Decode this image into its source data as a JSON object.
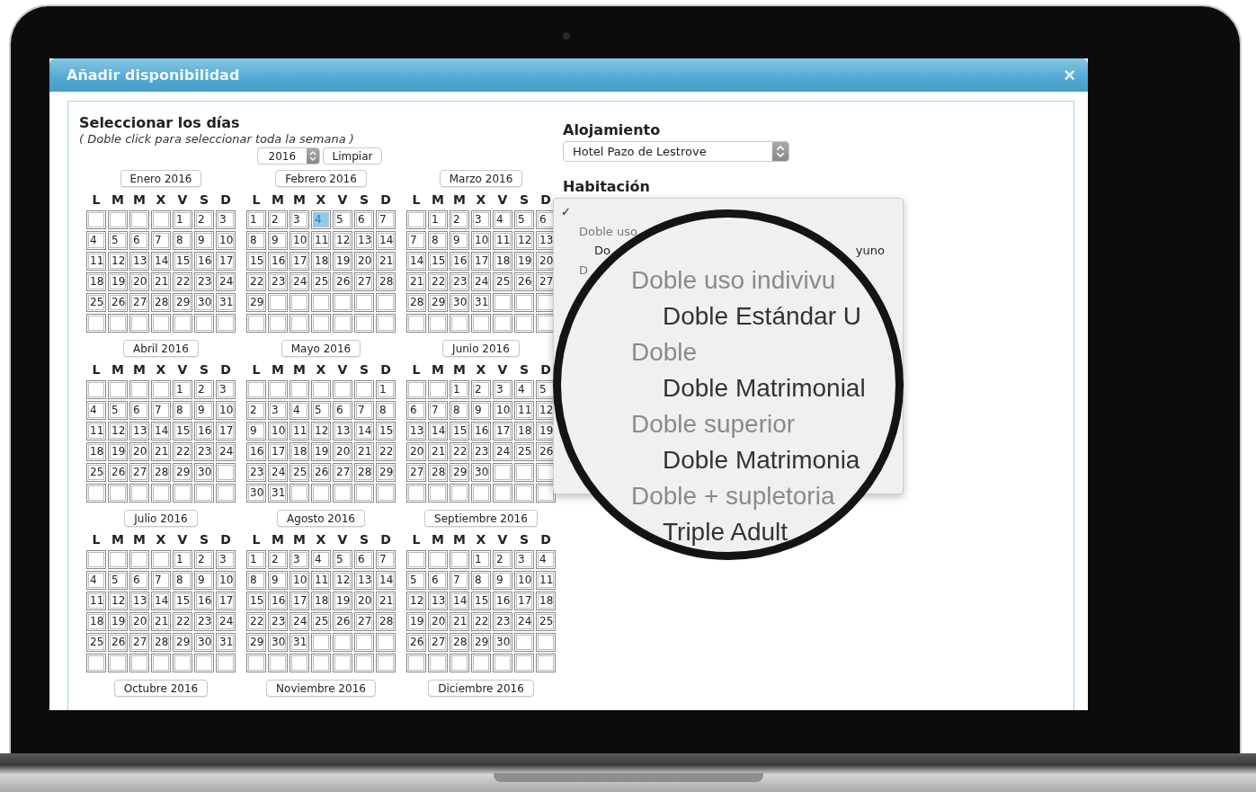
{
  "dialog": {
    "title": "Añadir disponibilidad",
    "close": "×"
  },
  "days_section": {
    "title": "Seleccionar los días",
    "hint": "( Doble click para seleccionar toda la semana )",
    "year": "2016",
    "clear": "Limpiar"
  },
  "months": [
    {
      "label": "Enero 2016",
      "weekdays": [
        "L",
        "M",
        "M",
        "X",
        "V",
        "S",
        "D"
      ],
      "weeks": [
        [
          {
            "kind": "blank"
          },
          {
            "kind": "blank"
          },
          {
            "kind": "blank"
          },
          {
            "kind": "blank"
          },
          "1",
          "2",
          "3"
        ],
        [
          "4",
          "5",
          "6",
          "7",
          "8",
          "9",
          "10"
        ],
        [
          "11",
          "12",
          "13",
          "14",
          "15",
          "16",
          "17"
        ],
        [
          "18",
          "19",
          "20",
          "21",
          "22",
          "23",
          "24"
        ],
        [
          "25",
          "26",
          "27",
          "28",
          "29",
          "30",
          "31"
        ],
        [
          {
            "kind": "blank"
          },
          {
            "kind": "blank"
          },
          {
            "kind": "blank"
          },
          {
            "kind": "blank"
          },
          {
            "kind": "blank"
          },
          {
            "kind": "blank"
          },
          {
            "kind": "blank"
          }
        ]
      ]
    },
    {
      "label": "Febrero 2016",
      "weekdays": [
        "L",
        "M",
        "M",
        "X",
        "V",
        "S",
        "D"
      ],
      "weeks": [
        [
          "1",
          "2",
          "3",
          {
            "kind": "day",
            "day": "4",
            "selected": true
          },
          "5",
          "6",
          "7"
        ],
        [
          "8",
          "9",
          "10",
          "11",
          "12",
          "13",
          "14"
        ],
        [
          "15",
          "16",
          "17",
          "18",
          "19",
          "20",
          "21"
        ],
        [
          "22",
          "23",
          "24",
          "25",
          "26",
          "27",
          "28"
        ],
        [
          "29",
          {
            "kind": "blank"
          },
          {
            "kind": "blank"
          },
          {
            "kind": "blank"
          },
          {
            "kind": "blank"
          },
          {
            "kind": "blank"
          },
          {
            "kind": "blank"
          }
        ],
        [
          {
            "kind": "blank"
          },
          {
            "kind": "blank"
          },
          {
            "kind": "blank"
          },
          {
            "kind": "blank"
          },
          {
            "kind": "blank"
          },
          {
            "kind": "blank"
          },
          {
            "kind": "blank"
          }
        ]
      ]
    },
    {
      "label": "Marzo 2016",
      "weekdays": [
        "L",
        "M",
        "M",
        "X",
        "V",
        "S",
        "D"
      ],
      "weeks": [
        [
          {
            "kind": "blank"
          },
          "1",
          "2",
          "3",
          "4",
          "5",
          "6"
        ],
        [
          "7",
          "8",
          "9",
          "10",
          "11",
          "12",
          "13"
        ],
        [
          "14",
          "15",
          "16",
          "17",
          "18",
          "19",
          "20"
        ],
        [
          "21",
          "22",
          "23",
          "24",
          "25",
          "26",
          "27"
        ],
        [
          "28",
          "29",
          "30",
          "31",
          {
            "kind": "blank"
          },
          {
            "kind": "blank"
          },
          {
            "kind": "blank"
          }
        ],
        [
          {
            "kind": "blank"
          },
          {
            "kind": "blank"
          },
          {
            "kind": "blank"
          },
          {
            "kind": "blank"
          },
          {
            "kind": "blank"
          },
          {
            "kind": "blank"
          },
          {
            "kind": "blank"
          }
        ]
      ]
    },
    {
      "label": "Abril 2016",
      "weekdays": [
        "L",
        "M",
        "M",
        "X",
        "V",
        "S",
        "D"
      ],
      "weeks": [
        [
          {
            "kind": "blank"
          },
          {
            "kind": "blank"
          },
          {
            "kind": "blank"
          },
          {
            "kind": "blank"
          },
          "1",
          "2",
          "3"
        ],
        [
          "4",
          "5",
          "6",
          "7",
          "8",
          "9",
          "10"
        ],
        [
          "11",
          "12",
          "13",
          "14",
          "15",
          "16",
          "17"
        ],
        [
          "18",
          "19",
          "20",
          "21",
          "22",
          "23",
          "24"
        ],
        [
          "25",
          "26",
          "27",
          "28",
          "29",
          "30",
          {
            "kind": "blank"
          }
        ],
        [
          {
            "kind": "blank"
          },
          {
            "kind": "blank"
          },
          {
            "kind": "blank"
          },
          {
            "kind": "blank"
          },
          {
            "kind": "blank"
          },
          {
            "kind": "blank"
          },
          {
            "kind": "blank"
          }
        ]
      ]
    },
    {
      "label": "Mayo 2016",
      "weekdays": [
        "L",
        "M",
        "M",
        "X",
        "V",
        "S",
        "D"
      ],
      "weeks": [
        [
          {
            "kind": "blank"
          },
          {
            "kind": "blank"
          },
          {
            "kind": "blank"
          },
          {
            "kind": "blank"
          },
          {
            "kind": "blank"
          },
          {
            "kind": "blank"
          },
          "1"
        ],
        [
          "2",
          "3",
          "4",
          "5",
          "6",
          "7",
          "8"
        ],
        [
          "9",
          "10",
          "11",
          "12",
          "13",
          "14",
          "15"
        ],
        [
          "16",
          "17",
          "18",
          "19",
          "20",
          "21",
          "22"
        ],
        [
          "23",
          "24",
          "25",
          "26",
          "27",
          "28",
          "29"
        ],
        [
          "30",
          "31",
          {
            "kind": "blank"
          },
          {
            "kind": "blank"
          },
          {
            "kind": "blank"
          },
          {
            "kind": "blank"
          },
          {
            "kind": "blank"
          }
        ]
      ]
    },
    {
      "label": "Junio 2016",
      "weekdays": [
        "L",
        "M",
        "M",
        "X",
        "V",
        "S",
        "D"
      ],
      "weeks": [
        [
          {
            "kind": "blank"
          },
          {
            "kind": "blank"
          },
          "1",
          "2",
          "3",
          "4",
          "5"
        ],
        [
          "6",
          "7",
          "8",
          "9",
          "10",
          "11",
          "12"
        ],
        [
          "13",
          "14",
          "15",
          "16",
          "17",
          "18",
          "19"
        ],
        [
          "20",
          "21",
          "22",
          "23",
          "24",
          "25",
          "26"
        ],
        [
          "27",
          "28",
          "29",
          "30",
          {
            "kind": "blank"
          },
          {
            "kind": "blank"
          },
          {
            "kind": "blank"
          }
        ],
        [
          {
            "kind": "blank"
          },
          {
            "kind": "blank"
          },
          {
            "kind": "blank"
          },
          {
            "kind": "blank"
          },
          {
            "kind": "blank"
          },
          {
            "kind": "blank"
          },
          {
            "kind": "blank"
          }
        ]
      ]
    },
    {
      "label": "Julio 2016",
      "weekdays": [
        "L",
        "M",
        "M",
        "X",
        "V",
        "S",
        "D"
      ],
      "weeks": [
        [
          {
            "kind": "blank"
          },
          {
            "kind": "blank"
          },
          {
            "kind": "blank"
          },
          {
            "kind": "blank"
          },
          "1",
          "2",
          "3"
        ],
        [
          "4",
          "5",
          "6",
          "7",
          "8",
          "9",
          "10"
        ],
        [
          "11",
          "12",
          "13",
          "14",
          "15",
          "16",
          "17"
        ],
        [
          "18",
          "19",
          "20",
          "21",
          "22",
          "23",
          "24"
        ],
        [
          "25",
          "26",
          "27",
          "28",
          "29",
          "30",
          "31"
        ],
        [
          {
            "kind": "blank"
          },
          {
            "kind": "blank"
          },
          {
            "kind": "blank"
          },
          {
            "kind": "blank"
          },
          {
            "kind": "blank"
          },
          {
            "kind": "blank"
          },
          {
            "kind": "blank"
          }
        ]
      ]
    },
    {
      "label": "Agosto 2016",
      "weekdays": [
        "L",
        "M",
        "M",
        "X",
        "V",
        "S",
        "D"
      ],
      "weeks": [
        [
          "1",
          "2",
          "3",
          "4",
          "5",
          "6",
          "7"
        ],
        [
          "8",
          "9",
          "10",
          "11",
          "12",
          "13",
          "14"
        ],
        [
          "15",
          "16",
          "17",
          "18",
          "19",
          "20",
          "21"
        ],
        [
          "22",
          "23",
          "24",
          "25",
          "26",
          "27",
          "28"
        ],
        [
          "29",
          "30",
          "31",
          {
            "kind": "blank"
          },
          {
            "kind": "blank"
          },
          {
            "kind": "blank"
          },
          {
            "kind": "blank"
          }
        ],
        [
          {
            "kind": "blank"
          },
          {
            "kind": "blank"
          },
          {
            "kind": "blank"
          },
          {
            "kind": "blank"
          },
          {
            "kind": "blank"
          },
          {
            "kind": "blank"
          },
          {
            "kind": "blank"
          }
        ]
      ]
    },
    {
      "label": "Septiembre 2016",
      "weekdays": [
        "L",
        "M",
        "M",
        "X",
        "V",
        "S",
        "D"
      ],
      "weeks": [
        [
          {
            "kind": "blank"
          },
          {
            "kind": "blank"
          },
          {
            "kind": "blank"
          },
          "1",
          "2",
          "3",
          "4"
        ],
        [
          "5",
          "6",
          "7",
          "8",
          "9",
          "10",
          "11"
        ],
        [
          "12",
          "13",
          "14",
          "15",
          "16",
          "17",
          "18"
        ],
        [
          "19",
          "20",
          "21",
          "22",
          "23",
          "24",
          "25"
        ],
        [
          "26",
          "27",
          "28",
          "29",
          "30",
          {
            "kind": "blank"
          },
          {
            "kind": "blank"
          }
        ],
        [
          {
            "kind": "blank"
          },
          {
            "kind": "blank"
          },
          {
            "kind": "blank"
          },
          {
            "kind": "blank"
          },
          {
            "kind": "blank"
          },
          {
            "kind": "blank"
          },
          {
            "kind": "blank"
          }
        ]
      ]
    },
    {
      "label": "Octubre 2016"
    },
    {
      "label": "Noviembre 2016"
    },
    {
      "label": "Diciembre 2016"
    }
  ],
  "accommodation": {
    "label": "Alojamiento",
    "value": "Hotel Pazo de Lestrove"
  },
  "room": {
    "label": "Habitación"
  },
  "room_menu": [
    {
      "kind": "check",
      "label": "✓"
    },
    {
      "kind": "group",
      "label": "Doble uso"
    },
    {
      "kind": "option",
      "label": "Do",
      "tail": "yuno"
    },
    {
      "kind": "group",
      "label": "D"
    }
  ],
  "magnifier": [
    {
      "kind": "group",
      "label": "Doble uso indivivu"
    },
    {
      "kind": "option",
      "label": "Doble Estándar U"
    },
    {
      "kind": "group",
      "label": "Doble"
    },
    {
      "kind": "option",
      "label": "Doble Matrimonial"
    },
    {
      "kind": "group",
      "label": "Doble superior"
    },
    {
      "kind": "option",
      "label": "Doble Matrimonia"
    },
    {
      "kind": "group",
      "label": "Doble + supletoria"
    },
    {
      "kind": "option",
      "label": "Triple Adult"
    }
  ]
}
